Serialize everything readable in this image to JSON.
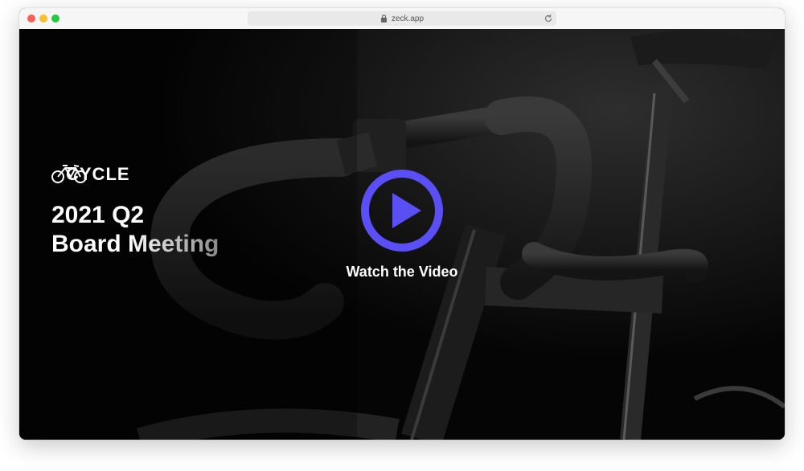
{
  "browser": {
    "url": "zeck.app"
  },
  "hero": {
    "brand_name": "CYCLE",
    "title_line1": "2021 Q2",
    "title_line2": "Board Meeting",
    "video_label": "Watch the Video",
    "accent_color": "#5a4ff5"
  },
  "icons": {
    "lock": "lock-icon",
    "reload": "reload-icon",
    "play": "play-icon",
    "brand_bike": "bicycle-icon"
  }
}
